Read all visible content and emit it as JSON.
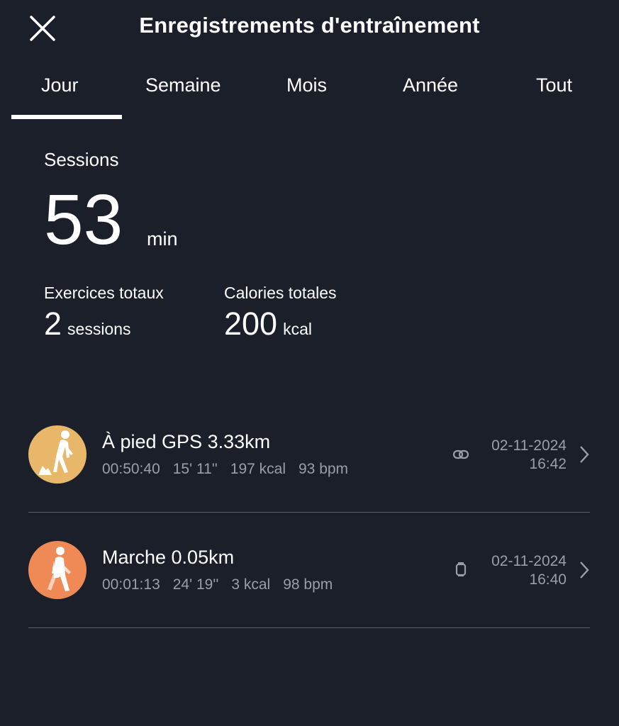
{
  "header": {
    "title": "Enregistrements d'entraînement",
    "close_icon": "close-icon"
  },
  "tabs": [
    {
      "label": "Jour",
      "active": true
    },
    {
      "label": "Semaine",
      "active": false
    },
    {
      "label": "Mois",
      "active": false
    },
    {
      "label": "Année",
      "active": false
    },
    {
      "label": "Tout",
      "active": false
    }
  ],
  "summary": {
    "label": "Sessions",
    "duration_value": "53",
    "duration_unit": "min",
    "total_exercises": {
      "label": "Exercices totaux",
      "value": "2",
      "unit": "sessions"
    },
    "total_calories": {
      "label": "Calories totales",
      "value": "200",
      "unit": "kcal"
    }
  },
  "workouts": [
    {
      "name": "À pied GPS 3.33km",
      "icon": "hiking-icon",
      "color": "#e8b76a",
      "duration": "00:50:40",
      "pace": "15' 11''",
      "calories": "197 kcal",
      "heart_rate": "93 bpm",
      "source_icon": "link-icon",
      "date": "02-11-2024",
      "time": "16:42"
    },
    {
      "name": "Marche 0.05km",
      "icon": "walking-icon",
      "color": "#ef8a57",
      "duration": "00:01:13",
      "pace": "24' 19''",
      "calories": "3 kcal",
      "heart_rate": "98 bpm",
      "source_icon": "watch-icon",
      "date": "02-11-2024",
      "time": "16:40"
    }
  ]
}
